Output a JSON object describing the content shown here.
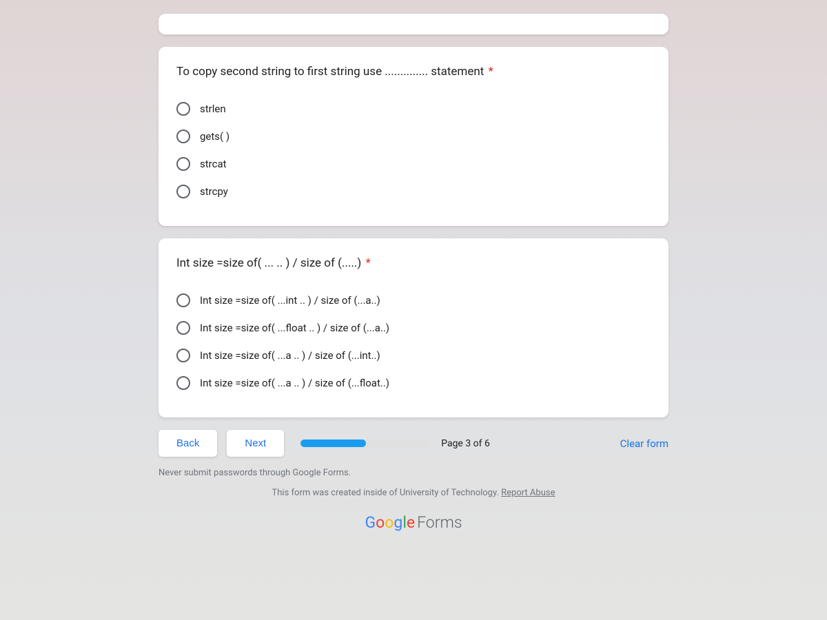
{
  "questions": [
    {
      "title": "To copy second string to first string use .............. statement",
      "required": "*",
      "options": [
        "strlen",
        "gets( )",
        "strcat",
        "strcpy"
      ]
    },
    {
      "title": "Int size =size of( ... .. ) / size of (.....)",
      "required": "*",
      "options": [
        "Int size =size of( ...int .. ) / size of (...a..)",
        "Int size =size of( ...float .. ) / size of (...a..)",
        "Int size =size of( ...a .. ) / size of (...int..)",
        "Int size =size of( ...a .. ) / size of (...float..)"
      ]
    }
  ],
  "nav": {
    "back": "Back",
    "next": "Next",
    "page_label": "Page 3 of 6",
    "clear": "Clear form"
  },
  "footer": {
    "warning": "Never submit passwords through Google Forms.",
    "created_prefix": "This form was created inside of University of Technology. ",
    "report_abuse": "Report Abuse",
    "brand_forms": "Forms"
  }
}
